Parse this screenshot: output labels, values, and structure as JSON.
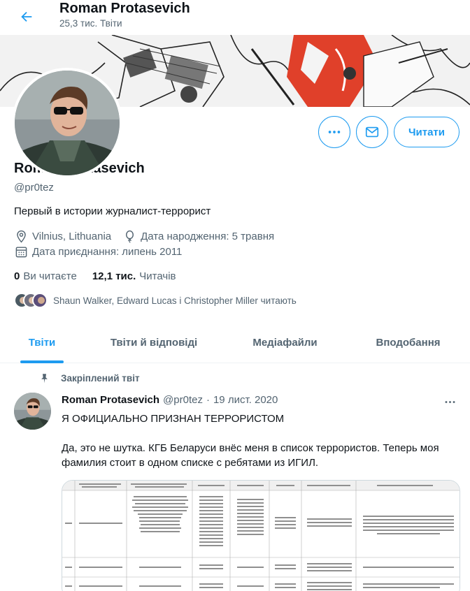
{
  "header": {
    "name": "Roman Protasevich",
    "tweet_count": "25,3 тис. Твіти"
  },
  "profile": {
    "name": "Roman Protasevich",
    "handle": "@pr0tez",
    "bio": "Первый в истории журналист-террорист",
    "location": "Vilnius, Lithuania",
    "birthday": "Дата народження: 5 травня",
    "joined": "Дата приєднання: липень 2011",
    "following_count": "0",
    "following_label": "Ви читаєте",
    "followers_count": "12,1 тис.",
    "followers_label": "Читачів",
    "known_followers": "Shaun Walker, Edward Lucas і Christopher Miller читають"
  },
  "actions": {
    "follow_label": "Читати"
  },
  "tabs": [
    {
      "label": "Твіти"
    },
    {
      "label": "Твіти й відповіді"
    },
    {
      "label": "Медіафайли"
    },
    {
      "label": "Вподобання"
    }
  ],
  "tweet": {
    "pinned_label": "Закріплений твіт",
    "name": "Roman Protasevich",
    "handle": "@pr0tez",
    "separator": "·",
    "date": "19 лист. 2020",
    "line1": "Я ОФИЦИАЛЬНО ПРИЗНАН ТЕРРОРИСТОМ",
    "line2": "Да, это не шутка. КГБ Беларуси внёс меня в список террористов. Теперь моя фамилия стоит в одном списке с ребятами из ИГИЛ."
  },
  "colors": {
    "accent": "#1d9bf0",
    "text_primary": "#0f1419",
    "text_secondary": "#536471",
    "banner_red": "#e0402a"
  },
  "icons": {
    "back": "arrow-left-icon",
    "more": "more-horizontal-icon",
    "message": "envelope-icon",
    "location": "location-pin-icon",
    "birthday": "balloon-icon",
    "joined": "calendar-icon",
    "pin": "pin-icon"
  }
}
